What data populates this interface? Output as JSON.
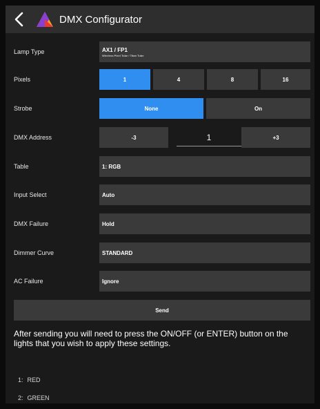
{
  "header": {
    "title": "DMX Configurator"
  },
  "lamp_type": {
    "label": "Lamp Type",
    "value": "AX1 / FP1",
    "subtitle": "Wireless Pixel Tube / Titan Tube"
  },
  "pixels": {
    "label": "Pixels",
    "options": [
      "1",
      "4",
      "8",
      "16"
    ],
    "selected": "1"
  },
  "strobe": {
    "label": "Strobe",
    "options": [
      "None",
      "On"
    ],
    "selected": "None"
  },
  "dmx_address": {
    "label": "DMX Address",
    "minus_label": "-3",
    "value": "1",
    "plus_label": "+3"
  },
  "table": {
    "label": "Table",
    "value": "1: RGB"
  },
  "input_select": {
    "label": "Input Select",
    "value": "Auto"
  },
  "dmx_failure": {
    "label": "DMX Failure",
    "value": "Hold"
  },
  "dimmer_curve": {
    "label": "Dimmer Curve",
    "value": "STANDARD"
  },
  "ac_failure": {
    "label": "AC Failure",
    "value": "Ignore"
  },
  "send_label": "Send",
  "instructions": "After sending you will need to press the ON/OFF (or ENTER) button on the lights that you wish to apply these settings.",
  "channels": [
    {
      "num": "1:",
      "name": "RED"
    },
    {
      "num": "2:",
      "name": "GREEN"
    }
  ],
  "colors": {
    "accent": "#2f8ef0",
    "button": "#3a3a3a",
    "background": "#1a1a1a",
    "topbar": "#2e2e2e"
  }
}
